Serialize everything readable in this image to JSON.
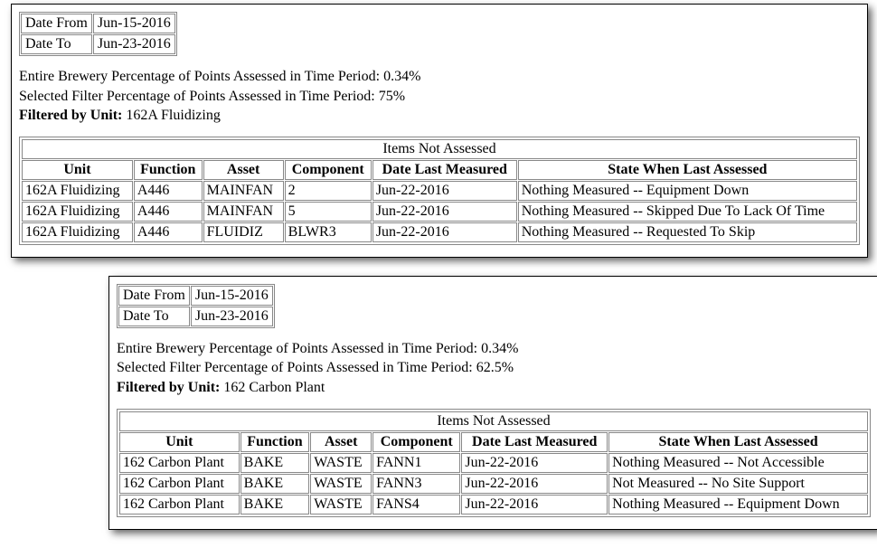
{
  "panels": [
    {
      "date_from_label": "Date From",
      "date_from_value": "Jun-15-2016",
      "date_to_label": "Date To",
      "date_to_value": "Jun-23-2016",
      "entire_line": "Entire Brewery Percentage of Points Assessed in Time Period: 0.34%",
      "selected_line": "Selected Filter Percentage of Points Assessed in Time Period: 75%",
      "filtered_label": "Filtered by Unit:",
      "filtered_value": " 162A Fluidizing",
      "items_title": "Items Not Assessed",
      "headers": {
        "unit": "Unit",
        "function": "Function",
        "asset": "Asset",
        "component": "Component",
        "date": "Date Last Measured",
        "state": "State When Last Assessed"
      },
      "rows": [
        {
          "unit": "162A Fluidizing",
          "function": "A446",
          "asset": "MAINFAN",
          "component": "2",
          "date": "Jun-22-2016",
          "state": "Nothing Measured -- Equipment Down"
        },
        {
          "unit": "162A Fluidizing",
          "function": "A446",
          "asset": "MAINFAN",
          "component": "5",
          "date": "Jun-22-2016",
          "state": "Nothing Measured -- Skipped Due To Lack Of Time"
        },
        {
          "unit": "162A Fluidizing",
          "function": "A446",
          "asset": "FLUIDIZ",
          "component": "BLWR3",
          "date": "Jun-22-2016",
          "state": "Nothing Measured -- Requested To Skip"
        }
      ]
    },
    {
      "date_from_label": "Date From",
      "date_from_value": "Jun-15-2016",
      "date_to_label": "Date To",
      "date_to_value": "Jun-23-2016",
      "entire_line": "Entire Brewery Percentage of Points Assessed in Time Period: 0.34%",
      "selected_line": "Selected Filter Percentage of Points Assessed in Time Period: 62.5%",
      "filtered_label": "Filtered by Unit:",
      "filtered_value": " 162 Carbon Plant",
      "items_title": "Items Not Assessed",
      "headers": {
        "unit": "Unit",
        "function": "Function",
        "asset": "Asset",
        "component": "Component",
        "date": "Date Last Measured",
        "state": "State When Last Assessed"
      },
      "rows": [
        {
          "unit": "162 Carbon Plant",
          "function": "BAKE",
          "asset": "WASTE",
          "component": "FANN1",
          "date": "Jun-22-2016",
          "state": "Nothing Measured -- Not Accessible"
        },
        {
          "unit": "162 Carbon Plant",
          "function": "BAKE",
          "asset": "WASTE",
          "component": "FANN3",
          "date": "Jun-22-2016",
          "state": "Not Measured -- No Site Support"
        },
        {
          "unit": "162 Carbon Plant",
          "function": "BAKE",
          "asset": "WASTE",
          "component": "FANS4",
          "date": "Jun-22-2016",
          "state": "Nothing Measured -- Equipment Down"
        }
      ]
    }
  ]
}
